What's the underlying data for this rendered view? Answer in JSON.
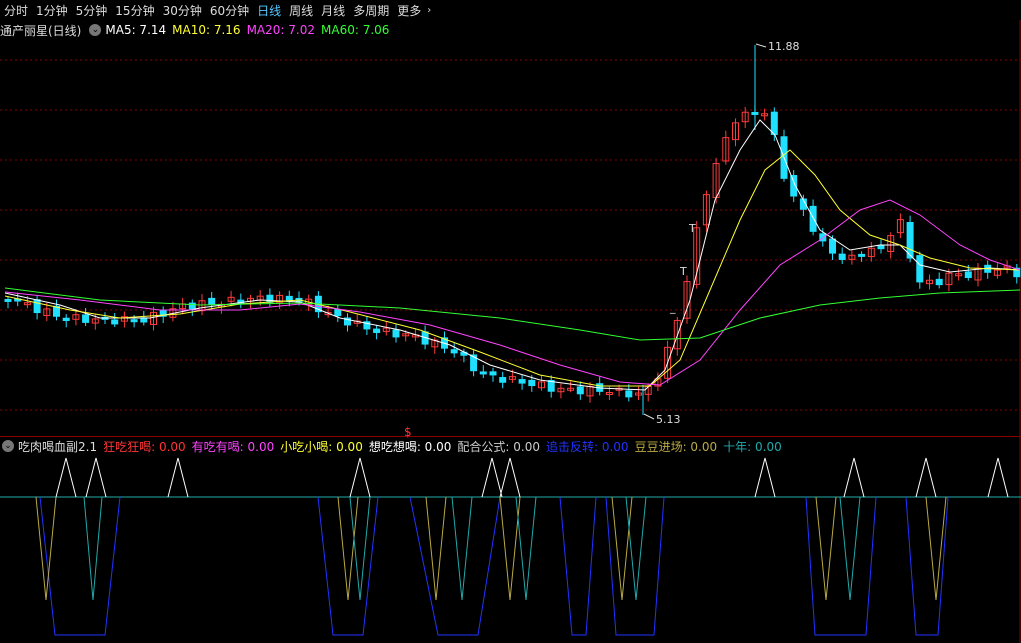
{
  "tabs": [
    {
      "label": "分时",
      "active": false
    },
    {
      "label": "1分钟",
      "active": false
    },
    {
      "label": "5分钟",
      "active": false
    },
    {
      "label": "15分钟",
      "active": false
    },
    {
      "label": "30分钟",
      "active": false
    },
    {
      "label": "60分钟",
      "active": false
    },
    {
      "label": "日线",
      "active": true
    },
    {
      "label": "周线",
      "active": false
    },
    {
      "label": "月线",
      "active": false
    },
    {
      "label": "多周期",
      "active": false
    },
    {
      "label": "更多",
      "active": false
    }
  ],
  "main_panel": {
    "title": "通产丽星(日线)",
    "indicators": [
      {
        "label": "MA5: 7.14",
        "color": "#ffffff"
      },
      {
        "label": "MA10: 7.16",
        "color": "#ffff33"
      },
      {
        "label": "MA20: 7.02",
        "color": "#ff44ff"
      },
      {
        "label": "MA60: 7.06",
        "color": "#33ff33"
      }
    ],
    "high_label": "11.88",
    "low_label": "5.13",
    "signal_mark": "$",
    "t_marks": [
      "T",
      "T",
      "_"
    ]
  },
  "sub_panel": {
    "title": "吃肉喝血副2.1",
    "indicators": [
      {
        "label": "狂吃狂喝: 0.00",
        "color": "#ff3333"
      },
      {
        "label": "有吃有喝: 0.00",
        "color": "#ff44ff"
      },
      {
        "label": "小吃小喝: 0.00",
        "color": "#ffff33"
      },
      {
        "label": "想吃想喝: 0.00",
        "color": "#ffffff"
      },
      {
        "label": "配合公式: 0.00",
        "color": "#cccccc"
      },
      {
        "label": "追击反转: 0.00",
        "color": "#2233ff"
      },
      {
        "label": "豆豆进场: 0.00",
        "color": "#bbaa44"
      },
      {
        "label": "十年: 0.00",
        "color": "#22aaaa"
      }
    ]
  },
  "colors": {
    "up": "#ff3b3b",
    "down": "#20e0ff",
    "ma5": "#ffffff",
    "ma10": "#ffff33",
    "ma20": "#ff44ff",
    "ma60": "#33ff33",
    "grid": "#8a0000"
  }
}
